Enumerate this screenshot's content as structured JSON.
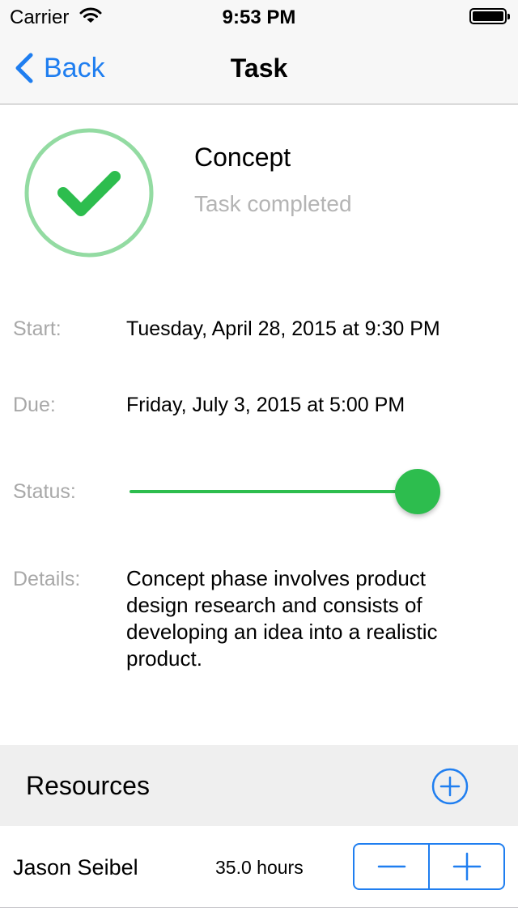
{
  "status_bar": {
    "carrier": "Carrier",
    "time": "9:53 PM"
  },
  "nav": {
    "back_label": "Back",
    "title": "Task"
  },
  "task": {
    "name": "Concept",
    "state": "Task completed",
    "icon": "checkmark-circle-icon",
    "accent_color": "#2dbd4e"
  },
  "fields": {
    "start_label": "Start:",
    "start_value": "Tuesday, April 28, 2015 at 9:30 PM",
    "due_label": "Due:",
    "due_value": "Friday, July 3, 2015 at 5:00 PM",
    "status_label": "Status:",
    "status_progress": 1.0,
    "details_label": "Details:",
    "details_value": "Concept phase involves product design research and consists of developing an idea into a realistic product."
  },
  "resources": {
    "title": "Resources",
    "add_icon": "plus-circle-icon",
    "items": [
      {
        "name": "Jason Seibel",
        "hours": "35.0 hours"
      }
    ]
  },
  "colors": {
    "tint": "#1f7ef0",
    "green": "#2dbd4e"
  }
}
